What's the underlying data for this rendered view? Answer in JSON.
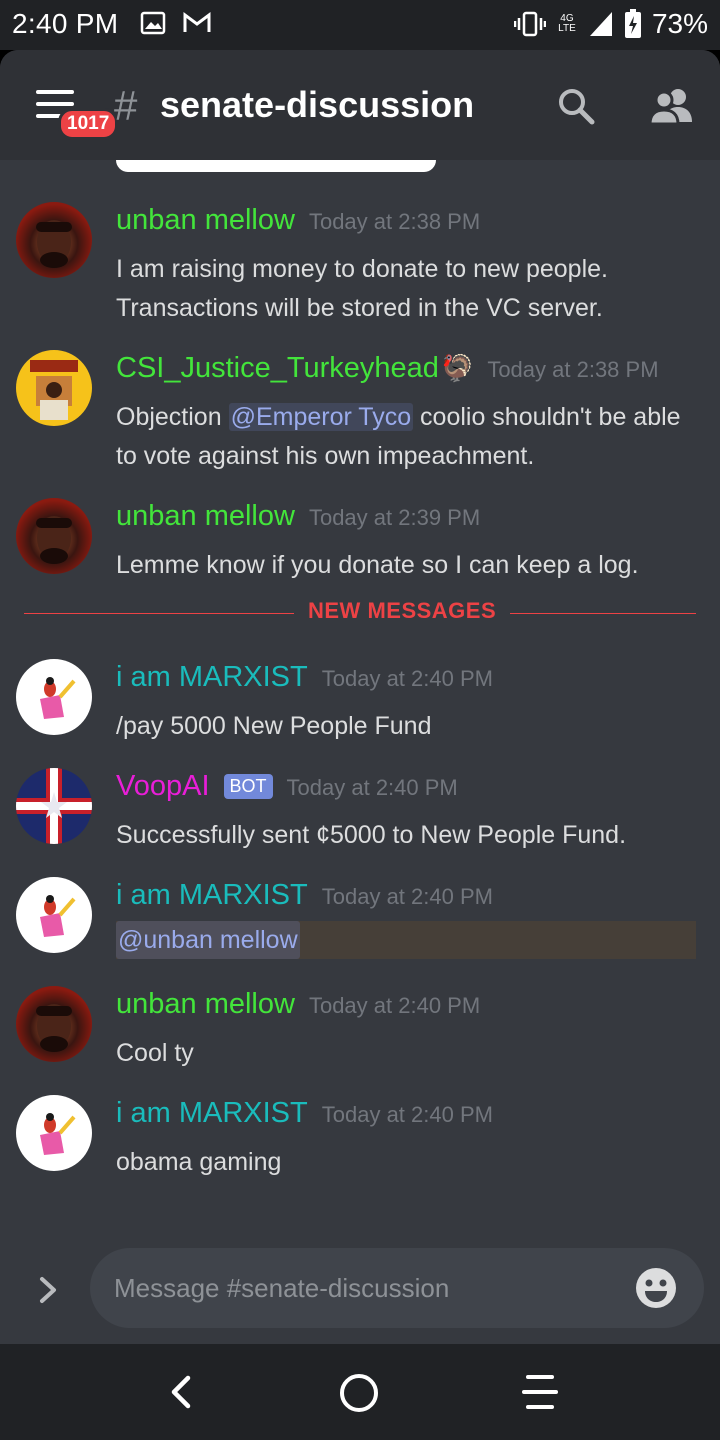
{
  "status_bar": {
    "time": "2:40 PM",
    "network": "4G LTE",
    "battery": "73%"
  },
  "header": {
    "hash": "#",
    "channel_name": "senate-discussion",
    "badge_count": "1017",
    "icons": [
      "menu-icon",
      "search-icon",
      "members-icon"
    ]
  },
  "divider_label": "NEW MESSAGES",
  "messages": [
    {
      "author": "unban mellow",
      "author_color": "#43e53b",
      "timestamp": "Today at 2:38 PM",
      "text": "I am raising money to donate to new people. Transactions will be stored in the VC server."
    },
    {
      "author": "CSI_Justice_Turkeyhead",
      "author_emoji": "🦃",
      "author_color": "#43e53b",
      "timestamp": "Today at 2:38 PM",
      "text_before": "Objection ",
      "mention": "@Emperor Tyco",
      "text_after": " coolio shouldn't be able to vote against his own impeachment."
    },
    {
      "author": "unban mellow",
      "author_color": "#43e53b",
      "timestamp": "Today at 2:39 PM",
      "text": "Lemme know if you donate so I can keep a log."
    },
    {
      "author": "i am MARXIST",
      "author_color": "#1abcbc",
      "timestamp": "Today at 2:40 PM",
      "text": "/pay 5000 New People Fund"
    },
    {
      "author": "VoopAI",
      "author_color": "#e91ed8",
      "bot_tag": "BOT",
      "timestamp": "Today at 2:40 PM",
      "text": "Successfully sent ¢5000 to New People Fund."
    },
    {
      "author": "i am MARXIST",
      "author_color": "#1abcbc",
      "timestamp": "Today at 2:40 PM",
      "mention": "@unban mellow"
    },
    {
      "author": "unban mellow",
      "author_color": "#43e53b",
      "timestamp": "Today at 2:40 PM",
      "text": "Cool ty"
    },
    {
      "author": "i am MARXIST",
      "author_color": "#1abcbc",
      "timestamp": "Today at 2:40 PM",
      "text": "obama gaming"
    }
  ],
  "composer": {
    "placeholder": "Message #senate-discussion"
  },
  "colors": {
    "background": "#36393f",
    "header": "#2f3136",
    "new_messages": "#ed4245",
    "mention": "#9aabec",
    "bot_tag": "#7289da"
  }
}
